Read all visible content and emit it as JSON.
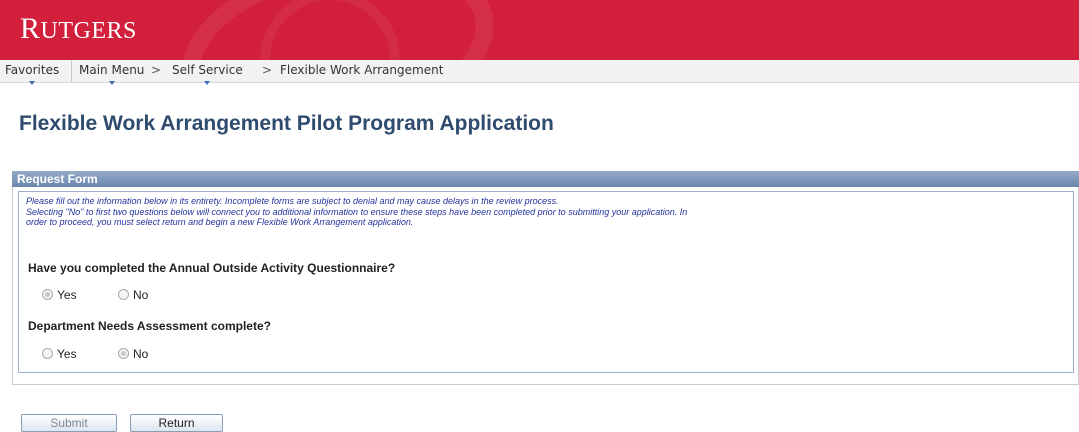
{
  "brand": {
    "logo_main": "RUTGERS",
    "color": "#d21f3c"
  },
  "nav": {
    "favorites": "Favorites",
    "main_menu": "Main Menu",
    "self_service": "Self Service",
    "current": "Flexible Work Arrangement",
    "separator": ">"
  },
  "page": {
    "title": "Flexible Work Arrangement Pilot Program Application"
  },
  "form": {
    "header": "Request Form",
    "notice_line1": "Please fill out the information below in its entirety. Incomplete forms are subject to denial and may cause delays in the review process.",
    "notice_line2": "Selecting \"No\" to first two questions below will connect you to additional information to ensure these steps have been completed prior to submitting your application. In",
    "notice_line3": "order to proceed, you must select return and begin a new Flexible Work Arrangement application.",
    "questions": [
      {
        "label": "Have you completed the Annual Outside Activity Questionnaire?",
        "yes": "Yes",
        "no": "No",
        "selected": "Yes"
      },
      {
        "label": "Department Needs Assessment complete?",
        "yes": "Yes",
        "no": "No",
        "selected": "No"
      }
    ]
  },
  "buttons": {
    "submit": "Submit",
    "return": "Return"
  }
}
